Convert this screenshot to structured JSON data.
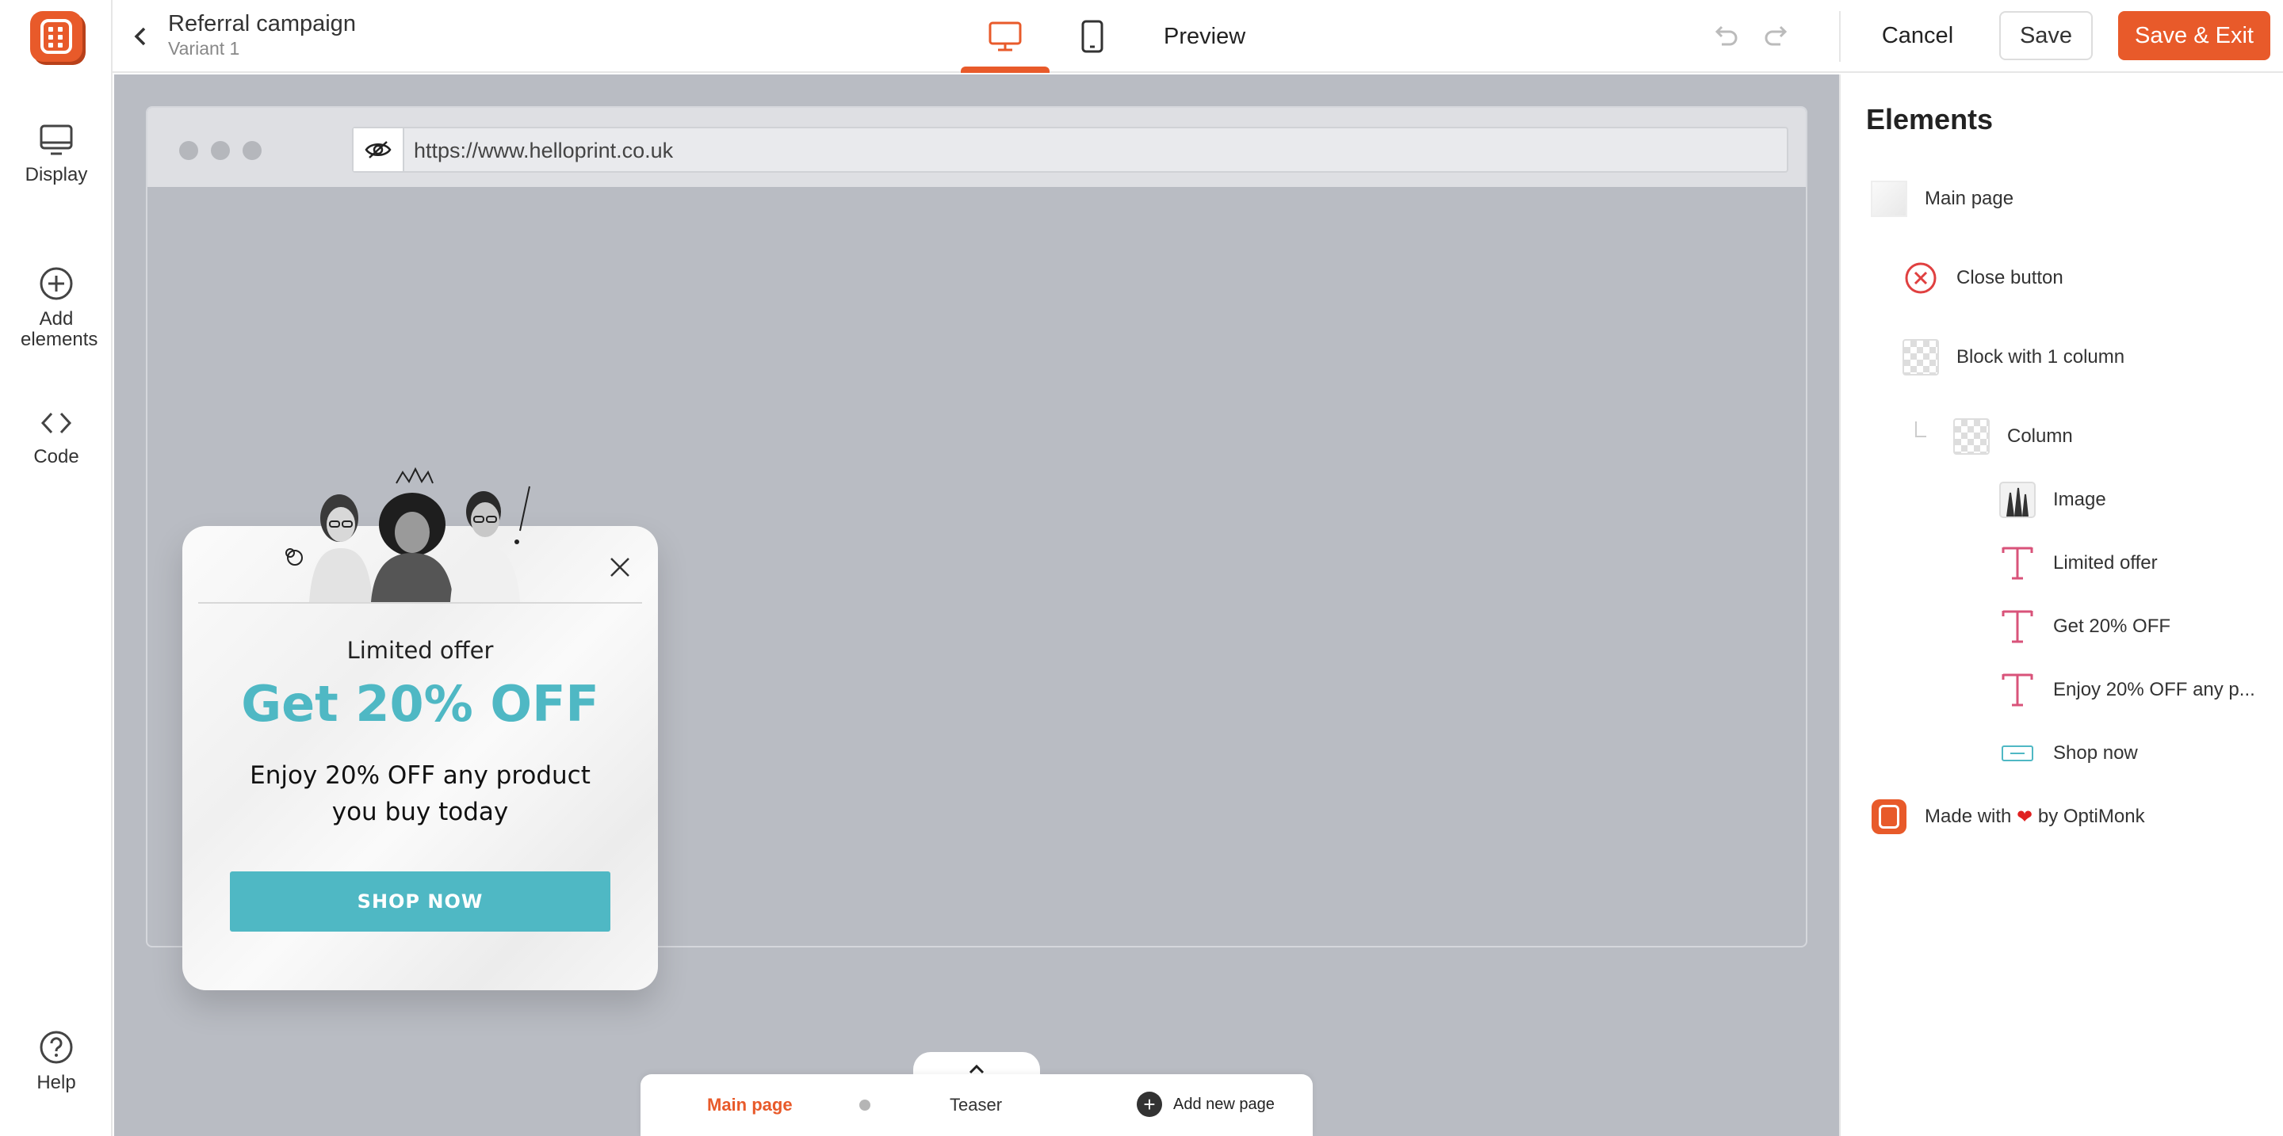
{
  "sidebar": {
    "items": [
      {
        "label": "Display",
        "icon": "monitor-icon"
      },
      {
        "label": "Add elements",
        "icon": "plus-circle-icon"
      },
      {
        "label": "Code",
        "icon": "code-icon"
      }
    ],
    "help_label": "Help"
  },
  "header": {
    "title": "Referral campaign",
    "variant": "Variant 1",
    "preview_label": "Preview",
    "cancel_label": "Cancel",
    "save_label": "Save",
    "save_exit_label": "Save & Exit",
    "active_device": "desktop"
  },
  "browser": {
    "url": "https://www.helloprint.co.uk"
  },
  "popup": {
    "limited_offer": "Limited offer",
    "headline": "Get 20% OFF",
    "body": "Enjoy 20% OFF any product you buy today",
    "cta": "SHOP NOW"
  },
  "pages": {
    "main": "Main page",
    "teaser": "Teaser",
    "add_new": "Add new page"
  },
  "elements_panel": {
    "title": "Elements",
    "items": [
      {
        "label": "Main page",
        "icon": "page-thumbnail-icon"
      },
      {
        "label": "Close button",
        "icon": "close-circle-icon"
      },
      {
        "label": "Block with 1 column",
        "icon": "block-icon"
      },
      {
        "label": "Column",
        "icon": "column-icon"
      },
      {
        "label": "Image",
        "icon": "image-icon"
      },
      {
        "label": "Limited offer",
        "icon": "text-icon"
      },
      {
        "label": "Get 20% OFF",
        "icon": "text-icon"
      },
      {
        "label": "Enjoy 20% OFF any p...",
        "icon": "text-icon"
      },
      {
        "label": "Shop now",
        "icon": "button-icon"
      }
    ],
    "made_with_prefix": "Made with",
    "made_with_suffix": "by OptiMonk"
  },
  "colors": {
    "accent": "#e85a2a",
    "cta": "#4fb8c4",
    "canvas": "#b9bcc3",
    "text_icon": "#d9537a"
  }
}
